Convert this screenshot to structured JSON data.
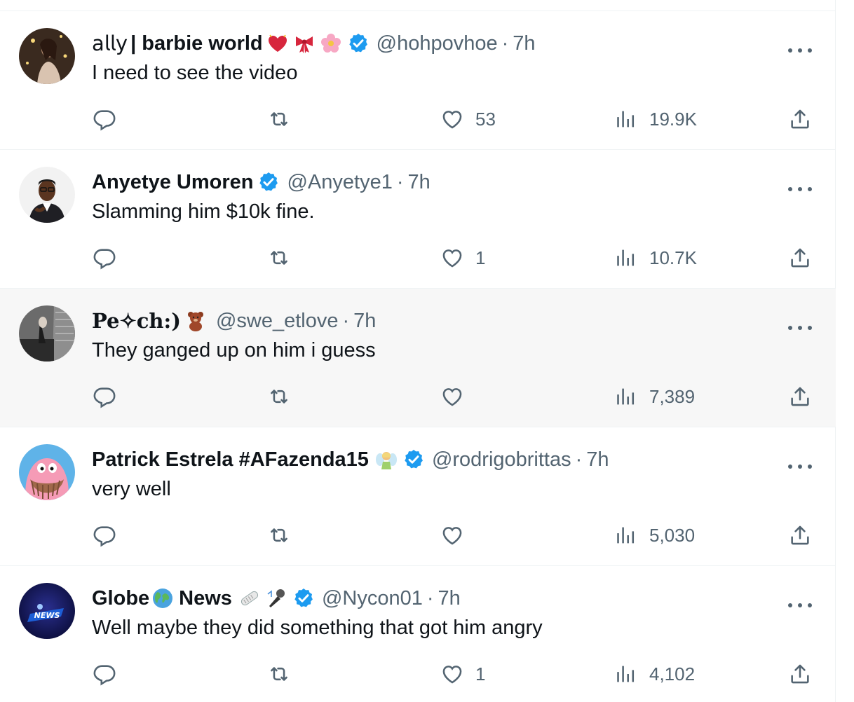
{
  "tweets": [
    {
      "name_prefix": "𝖺𝗅𝗅𝗒",
      "name": "| barbie world",
      "emojis": [
        "heart-icon",
        "ribbon-icon",
        "cherry-blossom-icon"
      ],
      "verified": true,
      "handle": "@hohpovhoe",
      "separator": "·",
      "time": "7h",
      "text": "I need to see the video",
      "replies": "",
      "retweets": "",
      "likes": "53",
      "views": "19.9K"
    },
    {
      "name": "Anyetye Umoren",
      "emojis": [],
      "verified": true,
      "handle": "@Anyetye1",
      "separator": "·",
      "time": "7h",
      "text": "Slamming him $10k fine.",
      "replies": "",
      "retweets": "",
      "likes": "1",
      "views": "10.7K"
    },
    {
      "name": "Pe✧ch:)",
      "emojis": [
        "teddy-bear-icon"
      ],
      "verified": false,
      "handle": "@swe_etlove",
      "separator": "·",
      "time": "7h",
      "text": "They ganged up on him i guess",
      "replies": "",
      "retweets": "",
      "likes": "",
      "views": "7,389",
      "highlighted": true
    },
    {
      "name": "Patrick Estrela #AFazenda15",
      "emojis": [
        "fairy-icon"
      ],
      "verified": true,
      "handle": "@rodrigobrittas",
      "separator": "·",
      "time": "7h",
      "text": "very well",
      "replies": "",
      "retweets": "",
      "likes": "",
      "views": "5,030"
    },
    {
      "name_a": "Globe",
      "name_b": "News",
      "emojis": [
        "globe-icon",
        "newspaper-icon",
        "microphone-icon"
      ],
      "verified": true,
      "handle": "@Nycon01",
      "separator": "·",
      "time": "7h",
      "text": "Well maybe they did something that got him angry",
      "replies": "",
      "retweets": "",
      "likes": "1",
      "views": "4,102",
      "avatar_text": "NEWS"
    }
  ],
  "colors": {
    "text_primary": "#0f1419",
    "text_secondary": "#536471",
    "verified_blue": "#1d9bf0",
    "divider": "#eff3f4",
    "highlight_bg": "#f7f7f7"
  }
}
